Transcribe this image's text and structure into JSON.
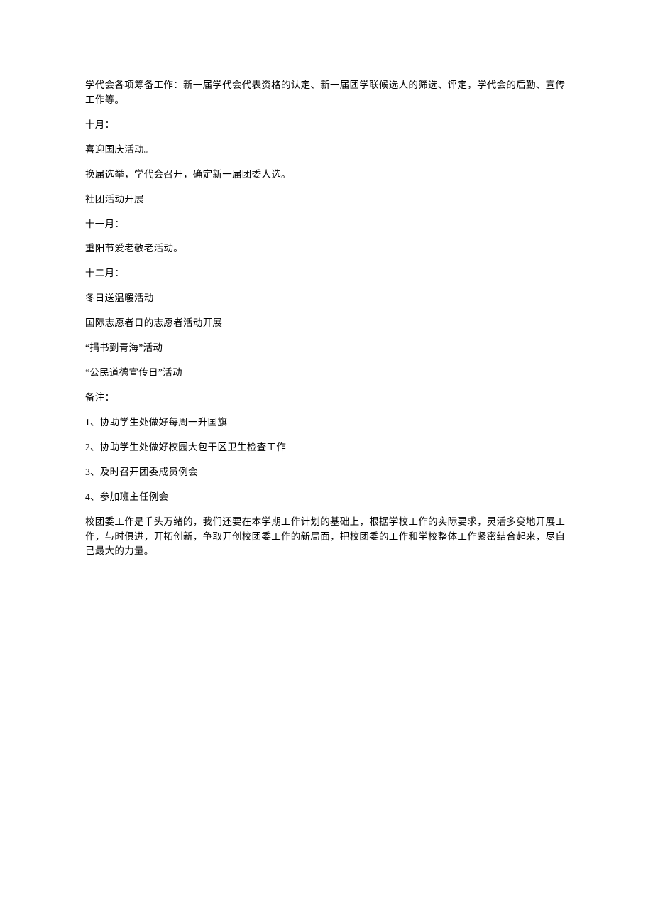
{
  "paragraphs": [
    "学代会各项筹备工作：新一届学代会代表资格的认定、新一届团学联候选人的筛选、评定，学代会的后勤、宣传工作等。",
    "十月：",
    "喜迎国庆活动。",
    "换届选举，学代会召开，确定新一届团委人选。",
    "社团活动开展",
    "十一月：",
    "重阳节爱老敬老活动。",
    "十二月：",
    "冬日送温暖活动",
    "国际志愿者日的志愿者活动开展",
    "“捐书到青海”活动",
    "“公民道德宣传日”活动",
    "备注：",
    "1、协助学生处做好每周一升国旗",
    "2、协助学生处做好校园大包干区卫生检查工作",
    "3、及时召开团委成员例会",
    "4、参加班主任例会",
    "校团委工作是千头万绪的，我们还要在本学期工作计划的基础上，根据学校工作的实际要求，灵活多变地开展工作，与时俱进，开拓创新，争取开创校团委工作的新局面，把校团委的工作和学校整体工作紧密结合起来，尽自己最大的力量。"
  ]
}
